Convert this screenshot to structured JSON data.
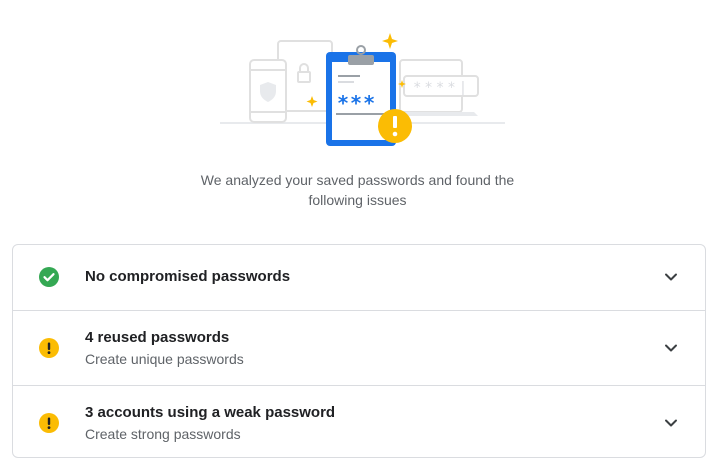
{
  "summary": {
    "line1": "We analyzed your saved passwords and found the",
    "line2": "following issues"
  },
  "illustration": {
    "masked_password": "***",
    "masked_field": "****|"
  },
  "issues": [
    {
      "title": "No compromised passwords",
      "subtitle": "",
      "status": "ok",
      "icon": "check-circle-icon"
    },
    {
      "title": "4 reused passwords",
      "subtitle": "Create unique passwords",
      "status": "warning",
      "icon": "warning-icon"
    },
    {
      "title": "3 accounts using a weak password",
      "subtitle": "Create strong passwords",
      "status": "warning",
      "icon": "warning-icon"
    }
  ],
  "colors": {
    "ok": "#34a853",
    "warning": "#fbbc04",
    "clipboard_blue": "#1a73e8",
    "border": "#dadce0",
    "text_secondary": "#5f6368"
  }
}
